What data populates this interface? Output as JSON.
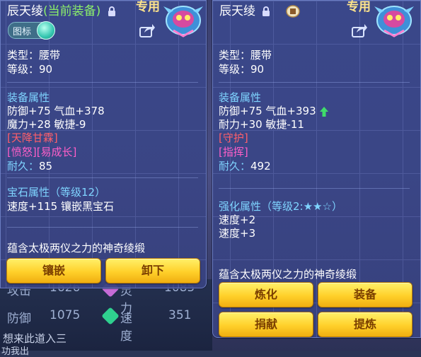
{
  "background": {
    "stats": [
      {
        "label": "攻击",
        "value": "1626",
        "label2": "灵力",
        "value2": "1085"
      },
      {
        "label": "防御",
        "value": "1075",
        "label2": "速度",
        "value2": "351"
      }
    ],
    "tail_text": "想来此道入三",
    "tail_text2": "功我出"
  },
  "left": {
    "title": "辰天绫",
    "title_tag": "(当前装备)",
    "exclusive": "专用",
    "toggle_label": "图标",
    "type": "类型：腰带",
    "level": "等级：90",
    "attr_header": "装备属性",
    "attr1": "防御+75 气血+378",
    "attr2": "魔力+28 敏捷-9",
    "special1": "[天降甘霖]",
    "special2": "[愤怒][易成长]",
    "durability_label": "耐久：",
    "durability_value": "85",
    "gem_header": "宝石属性（等级12）",
    "gem_line": "速度+115 镶嵌黑宝石",
    "desc": "蕴含太极两仪之力的神奇绫缎",
    "btn1": "镶嵌",
    "btn2": "卸下"
  },
  "right": {
    "title": "辰天绫",
    "exclusive": "专用",
    "type": "类型：腰带",
    "level": "等级：90",
    "attr_header": "装备属性",
    "attr1": "防御+75 气血+393",
    "attr2": "耐力+30 敏捷-11",
    "special1": "[守护]",
    "special2": "[指挥]",
    "durability_label": "耐久：",
    "durability_value": "492",
    "enh_header": "强化属性（等级2:★★☆）",
    "enh1": "速度+2",
    "enh2": "速度+3",
    "desc": "蕴含太极两仪之力的神奇绫缎",
    "btn1": "炼化",
    "btn2": "装备",
    "btn3": "捐献",
    "btn4": "提炼"
  },
  "colors": {
    "accent": "#7fd4ff",
    "tag_green": "#8cf06a",
    "special_red": "#ff5f6a",
    "special_pink": "#ff5fc8",
    "button": "#ffd02a"
  }
}
